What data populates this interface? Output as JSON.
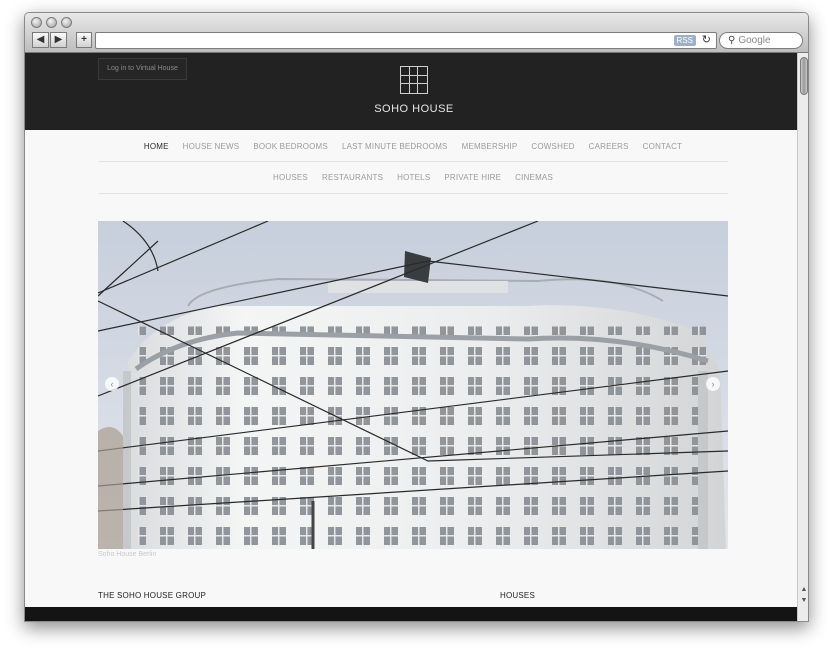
{
  "browser": {
    "back_label": "◀",
    "forward_label": "▶",
    "new_tab_label": "+",
    "rss_label": "RSS",
    "reload_icon": "↻",
    "search_placeholder": "Google",
    "url": ""
  },
  "header": {
    "login_label": "Log in to Virtual House",
    "brand": "SOHO HOUSE",
    "background": "#222222"
  },
  "nav_main": [
    {
      "label": "HOME",
      "active": true
    },
    {
      "label": "HOUSE NEWS"
    },
    {
      "label": "BOOK BEDROOMS"
    },
    {
      "label": "LAST MINUTE BEDROOMS"
    },
    {
      "label": "MEMBERSHIP"
    },
    {
      "label": "COWSHED"
    },
    {
      "label": "CAREERS"
    },
    {
      "label": "CONTACT"
    }
  ],
  "nav_sub": [
    {
      "label": "HOUSES"
    },
    {
      "label": "RESTAURANTS"
    },
    {
      "label": "HOTELS"
    },
    {
      "label": "PRIVATE HIRE"
    },
    {
      "label": "CINEMAS"
    }
  ],
  "hero": {
    "caption": "Soho House Berlin",
    "prev_icon": "‹",
    "next_icon": "›"
  },
  "footer": {
    "left_heading": "THE SOHO HOUSE GROUP",
    "right_heading": "HOUSES"
  }
}
